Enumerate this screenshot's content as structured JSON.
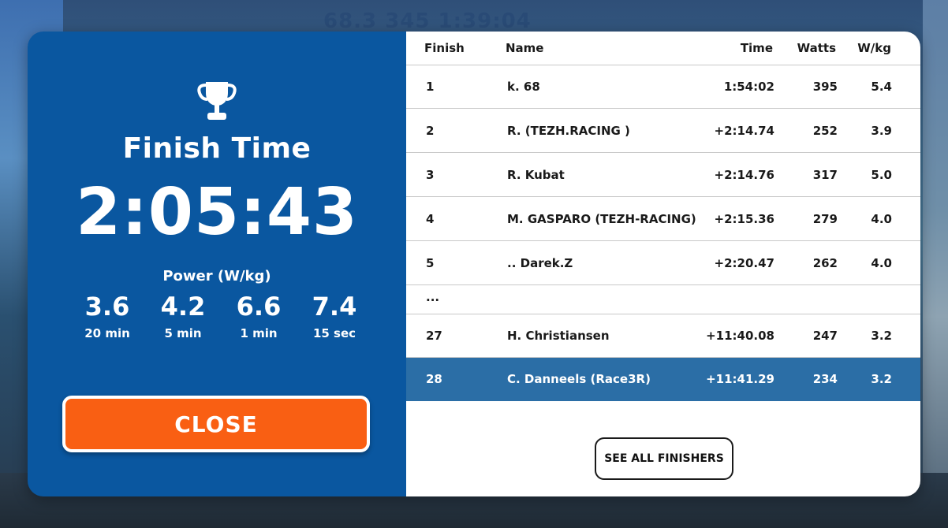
{
  "background": {
    "hud_text": "68.3 345 1:39:04"
  },
  "summary": {
    "title": "Finish Time",
    "time": "2:05:43",
    "power_label": "Power (W/kg)",
    "power": [
      {
        "value": "3.6",
        "duration": "20 min"
      },
      {
        "value": "4.2",
        "duration": "5 min"
      },
      {
        "value": "6.6",
        "duration": "1 min"
      },
      {
        "value": "7.4",
        "duration": "15 sec"
      }
    ],
    "close_label": "CLOSE"
  },
  "results": {
    "headers": {
      "finish": "Finish",
      "name": "Name",
      "time": "Time",
      "watts": "Watts",
      "wkg": "W/kg"
    },
    "rows": [
      {
        "finish": "1",
        "name": "k. 68",
        "time": "1:54:02",
        "watts": "395",
        "wkg": "5.4"
      },
      {
        "finish": "2",
        "name": "R. (TEZH.RACING )",
        "time": "+2:14.74",
        "watts": "252",
        "wkg": "3.9"
      },
      {
        "finish": "3",
        "name": "R. Kubat",
        "time": "+2:14.76",
        "watts": "317",
        "wkg": "5.0"
      },
      {
        "finish": "4",
        "name": "M. GASPARO (TEZH-RACING)",
        "time": "+2:15.36",
        "watts": "279",
        "wkg": "4.0"
      },
      {
        "finish": "5",
        "name": ".. Darek.Z",
        "time": "+2:20.47",
        "watts": "262",
        "wkg": "4.0"
      }
    ],
    "ellipsis": "...",
    "rows_after": [
      {
        "finish": "27",
        "name": "H. Christiansen",
        "time": "+11:40.08",
        "watts": "247",
        "wkg": "3.2"
      },
      {
        "finish": "28",
        "name": "C. Danneels (Race3R)",
        "time": "+11:41.29",
        "watts": "234",
        "wkg": "3.2"
      }
    ],
    "see_all_label": "SEE ALL FINISHERS"
  },
  "colors": {
    "panel_blue": "#0a57a0",
    "highlight_row": "#2b6ea6",
    "close_orange": "#f95f13"
  }
}
